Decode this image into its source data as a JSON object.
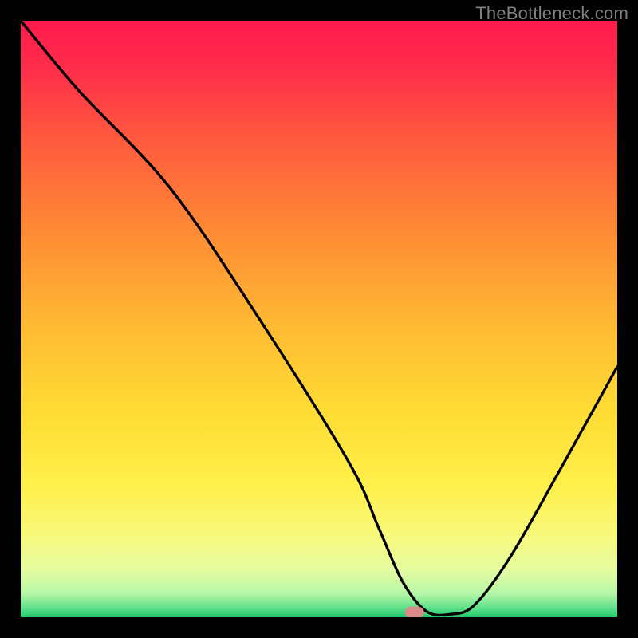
{
  "watermark": "TheBottleneck.com",
  "chart_data": {
    "type": "line",
    "title": "",
    "xlabel": "",
    "ylabel": "",
    "xlim": [
      0,
      100
    ],
    "ylim": [
      0,
      100
    ],
    "grid": false,
    "legend": false,
    "annotations": [],
    "background": "red-yellow-green vertical gradient",
    "series": [
      {
        "name": "curve",
        "x": [
          0,
          10,
          25,
          40,
          55,
          60,
          64,
          68,
          72,
          76,
          82,
          90,
          100
        ],
        "y": [
          100,
          88,
          72,
          50,
          26,
          15,
          6,
          1,
          0.5,
          2,
          10,
          24,
          42
        ]
      }
    ],
    "marker": {
      "x_center": 66,
      "y_center": 0.8,
      "width": 3.2,
      "height": 2.0,
      "color": "#d98a8a"
    }
  },
  "colors": {
    "gradient_stops": [
      {
        "offset": 0.0,
        "color": "#ff1a4d"
      },
      {
        "offset": 0.08,
        "color": "#ff2d4a"
      },
      {
        "offset": 0.2,
        "color": "#ff5a3e"
      },
      {
        "offset": 0.35,
        "color": "#ff8a35"
      },
      {
        "offset": 0.5,
        "color": "#ffb733"
      },
      {
        "offset": 0.65,
        "color": "#ffdb33"
      },
      {
        "offset": 0.78,
        "color": "#fff04a"
      },
      {
        "offset": 0.86,
        "color": "#f8f97a"
      },
      {
        "offset": 0.92,
        "color": "#e6fca0"
      },
      {
        "offset": 0.96,
        "color": "#b6f7a8"
      },
      {
        "offset": 0.985,
        "color": "#5de08a"
      },
      {
        "offset": 1.0,
        "color": "#1fc96e"
      }
    ],
    "curve": "#000000",
    "marker": "#d98a8a"
  }
}
